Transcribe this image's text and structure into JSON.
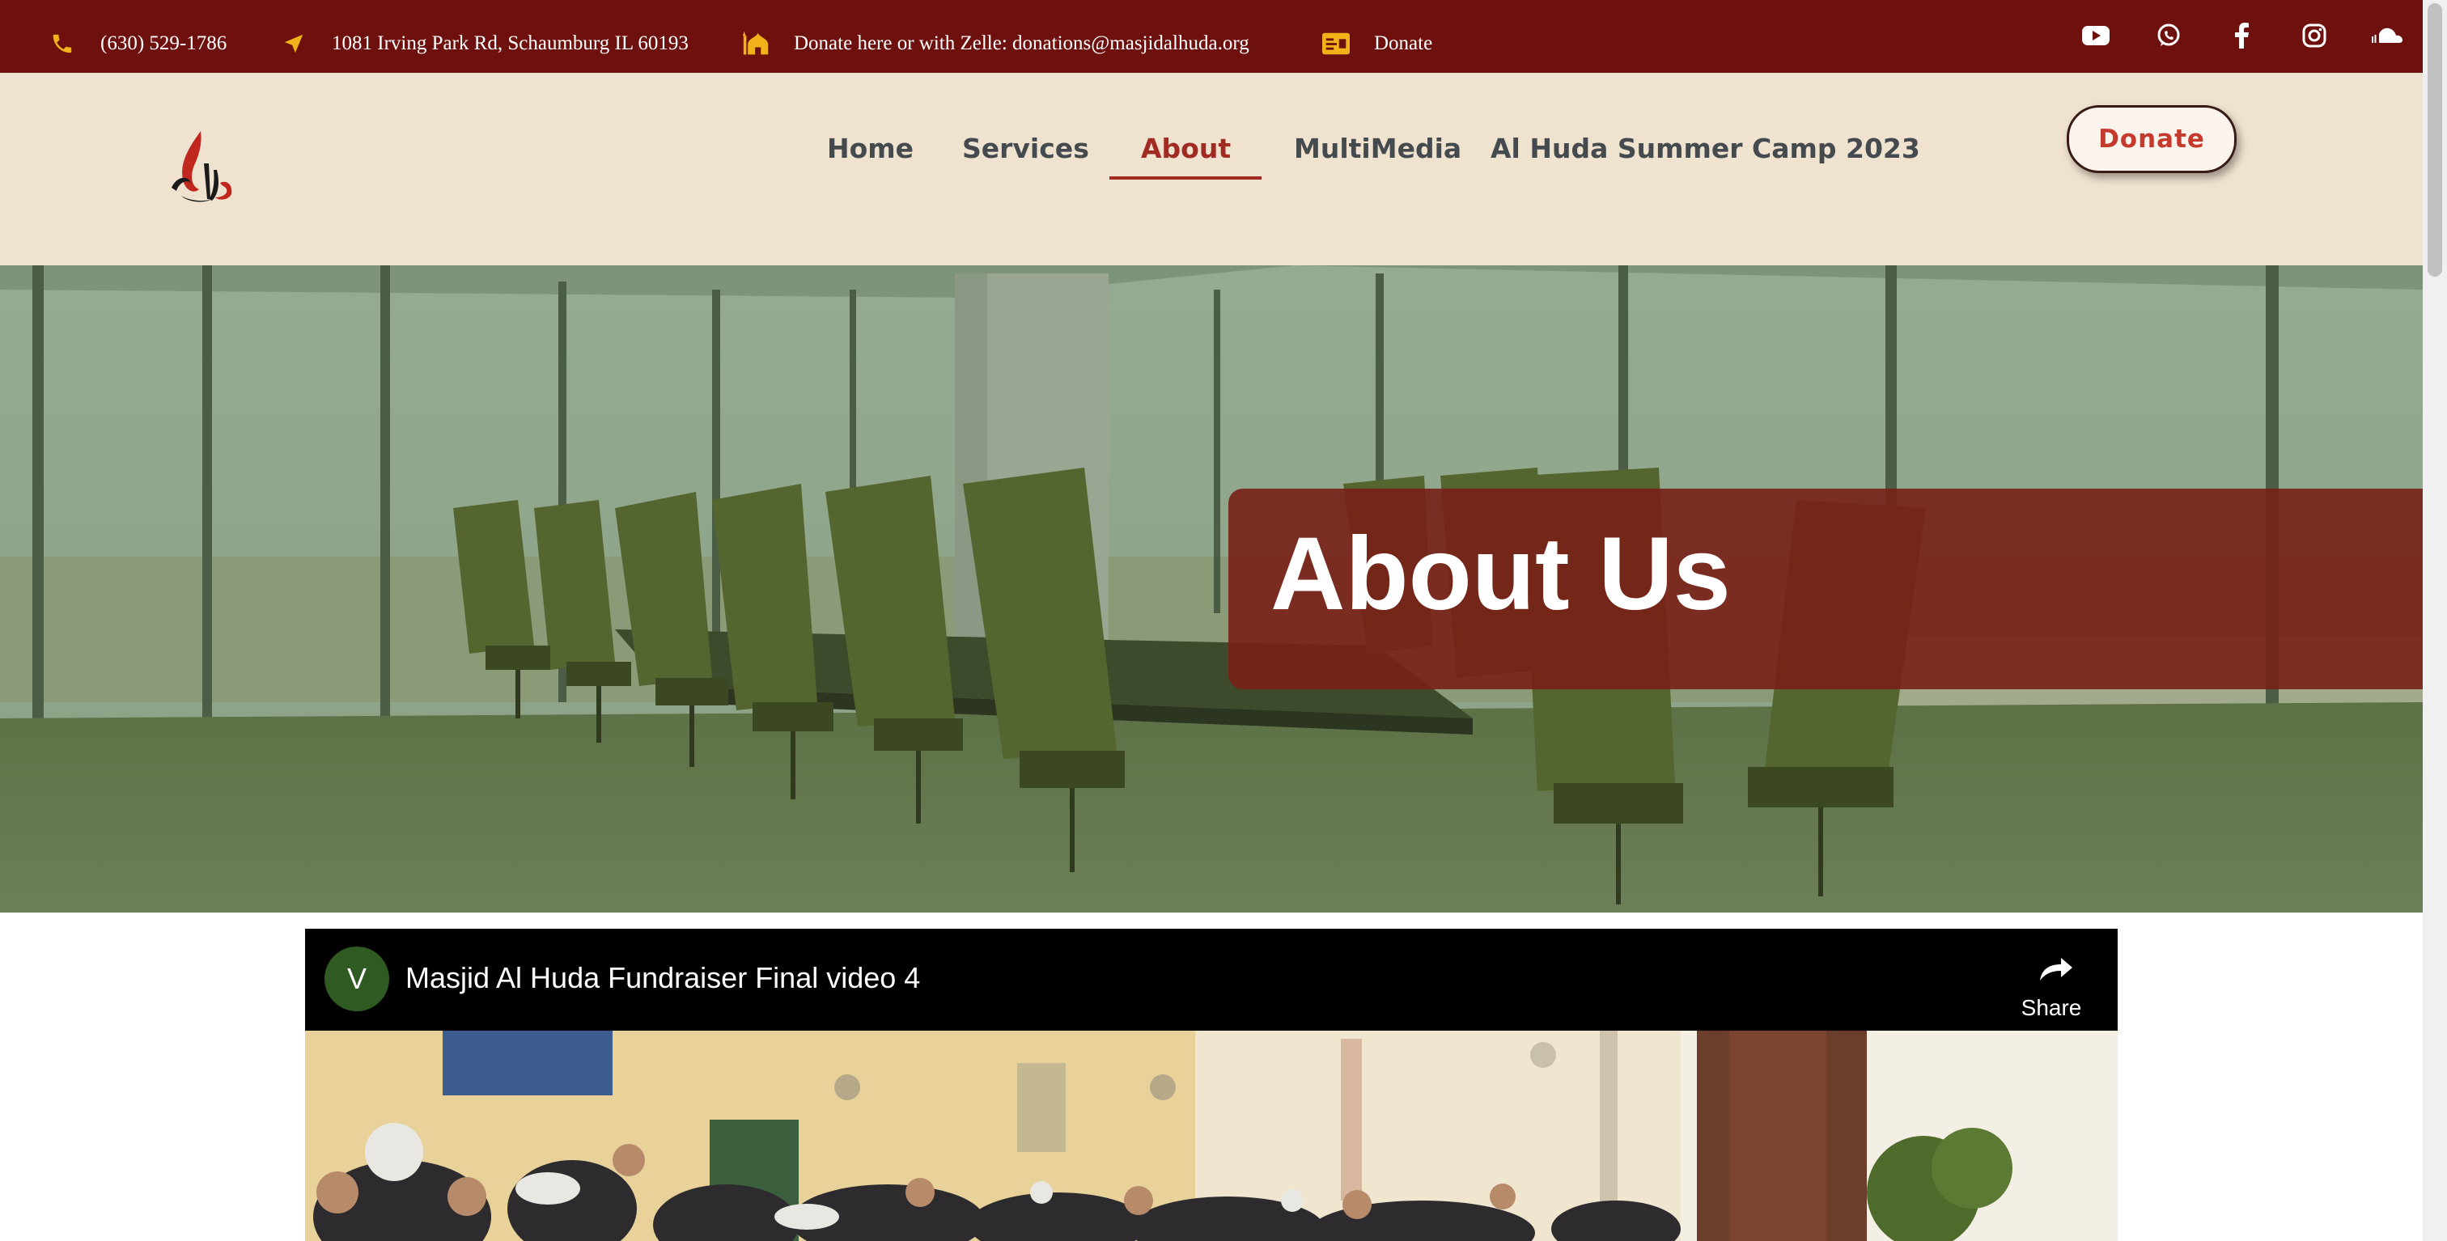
{
  "topbar": {
    "phone": "(630) 529-1786",
    "address": "1081 Irving Park Rd, Schaumburg IL 60193",
    "zelle": "Donate here or with Zelle: donations@masjidalhuda.org",
    "donate": "Donate",
    "icons": [
      "phone-icon",
      "location-arrow-icon",
      "mosque-icon",
      "id-card-icon"
    ],
    "social_icons": [
      "youtube-icon",
      "whatsapp-icon",
      "facebook-icon",
      "instagram-icon",
      "soundcloud-icon"
    ],
    "background": "#6e110e",
    "icon_color": "#f2b21a"
  },
  "nav": {
    "items": [
      "Home",
      "Services",
      "About",
      "MultiMedia",
      "Al Huda Summer Camp 2023"
    ],
    "active": "About",
    "donate_button": "Donate",
    "accent": "#a12b22",
    "background": "#efe2cf"
  },
  "hero": {
    "title": "About Us",
    "banner_color": "#782016"
  },
  "video": {
    "channel_initial": "V",
    "title": "Masjid Al Huda Fundraiser Final video 4",
    "share_label": "Share"
  }
}
